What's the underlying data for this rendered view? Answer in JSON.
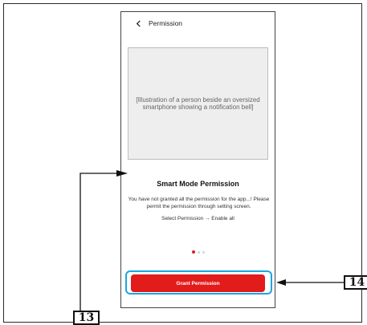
{
  "phone": {
    "topbar": {
      "title": "Permission"
    },
    "illustration": {
      "label": "[Illustration of a person beside an oversized smartphone showing a notification bell]"
    },
    "content": {
      "heading": "Smart Mode Permission",
      "description": "You have not granted all the permission for the app...! Please permit the permission through setting screen.",
      "hint": "Select Permission → Enable all"
    },
    "pager": {
      "count": 3,
      "active_index": 0
    },
    "grant_button_label": "Grant Permission"
  },
  "callouts": {
    "c13": "13",
    "c14": "14"
  },
  "colors": {
    "accent_red": "#e21b1b",
    "highlight_blue": "#1aa6e0"
  }
}
